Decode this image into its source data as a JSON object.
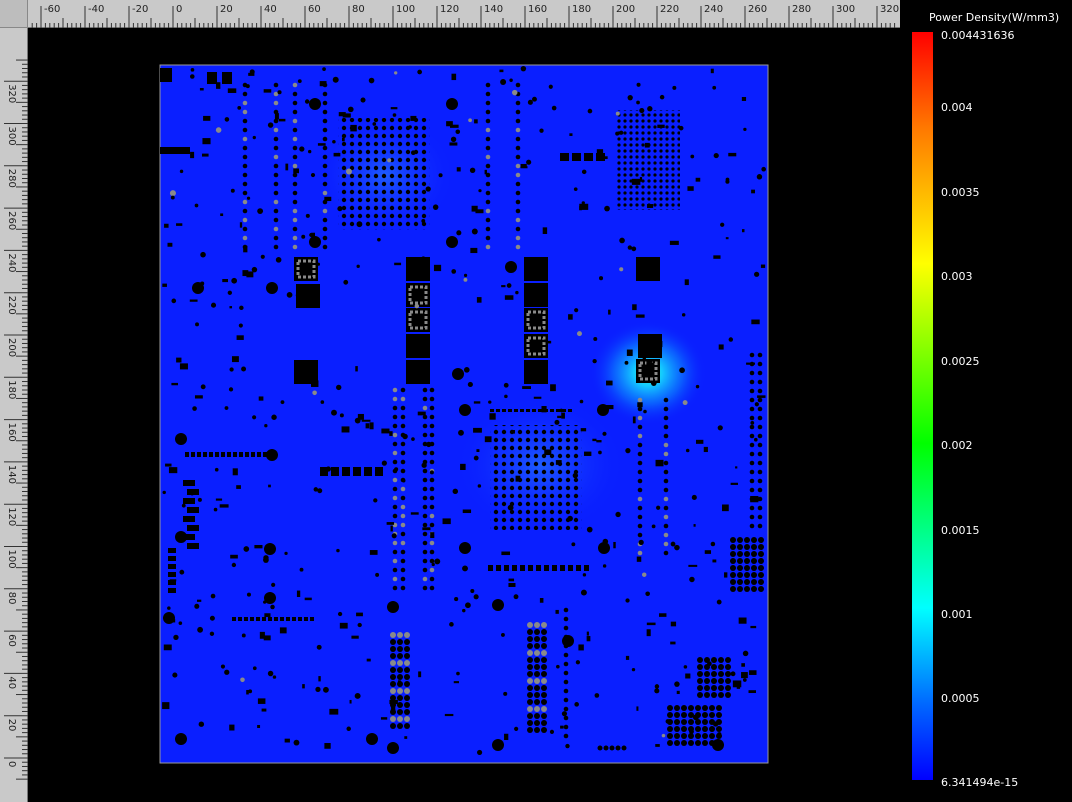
{
  "ruler": {
    "top_labels": [
      "-60",
      "-40",
      "-20",
      "0",
      "20",
      "40",
      "60",
      "80",
      "100",
      "120",
      "140",
      "160",
      "180",
      "200",
      "220",
      "240",
      "260",
      "280",
      "300",
      "320"
    ],
    "left_labels": [
      "320",
      "300",
      "280",
      "260",
      "240",
      "220",
      "200",
      "180",
      "160",
      "140",
      "120",
      "100",
      "80",
      "60",
      "40",
      "20",
      "0"
    ]
  },
  "legend": {
    "title": "Power Density(W/mm3)",
    "labels": [
      "0.004431636",
      "0.004",
      "0.0035",
      "0.003",
      "0.0025",
      "0.002",
      "0.0015",
      "0.001",
      "0.0005",
      "6.341494e-15"
    ]
  },
  "colors": {
    "board": "#0a1fff",
    "hotspot": "#21e7ff",
    "component": "#000000",
    "pad": "#8a8a8a",
    "outline": "#9a9a9a",
    "ruler_bg": "#c9c9c9"
  }
}
